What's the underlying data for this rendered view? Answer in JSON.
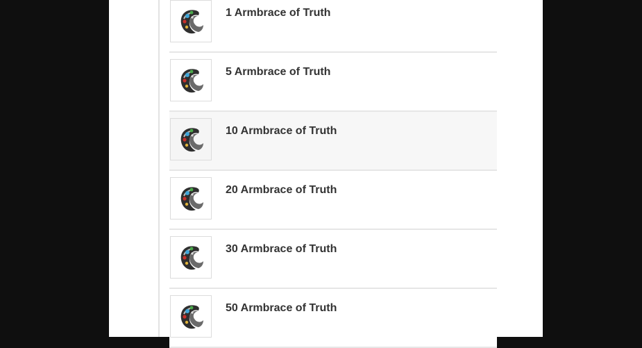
{
  "items": [
    {
      "label": "1 Armbrace of Truth",
      "icon": "armbrace-icon"
    },
    {
      "label": "5 Armbrace of Truth",
      "icon": "armbrace-icon"
    },
    {
      "label": "10 Armbrace of Truth",
      "icon": "armbrace-icon"
    },
    {
      "label": "20 Armbrace of Truth",
      "icon": "armbrace-icon"
    },
    {
      "label": "30 Armbrace of Truth",
      "icon": "armbrace-icon"
    },
    {
      "label": "50 Armbrace of Truth",
      "icon": "armbrace-icon"
    }
  ],
  "colors": {
    "backdrop": "#0f0f0f",
    "panel": "#ffffff",
    "text": "#333333",
    "row_hover": "#f7f7f7",
    "divider": "#e6e6e6",
    "gem_blue": "#3fa6d8",
    "gem_red": "#c8302a",
    "gem_green": "#4aa84a",
    "gem_gold": "#e0b33a"
  }
}
